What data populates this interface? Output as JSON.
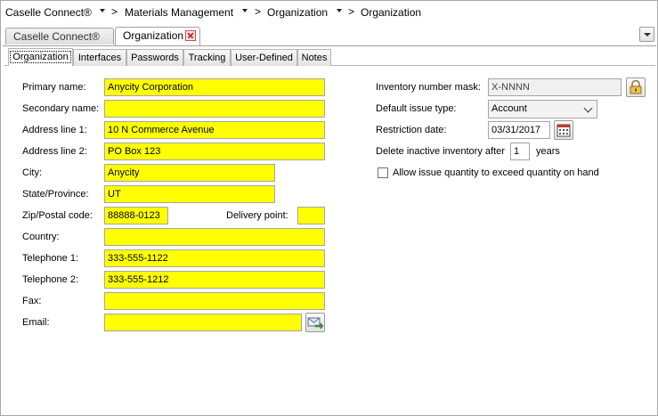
{
  "breadcrumb": {
    "items": [
      "Caselle Connect®",
      "Materials Management",
      "Organization",
      "Organization"
    ],
    "separator": ">"
  },
  "doc_tabs": [
    {
      "label": "Caselle Connect®",
      "active": false
    },
    {
      "label": "Organization",
      "active": true
    }
  ],
  "sub_tabs": [
    "Organization",
    "Interfaces",
    "Passwords",
    "Tracking",
    "User-Defined",
    "Notes"
  ],
  "form": {
    "primary_name": {
      "label": "Primary name:",
      "value": "Anycity Corporation"
    },
    "secondary_name": {
      "label": "Secondary name:",
      "value": ""
    },
    "address1": {
      "label": "Address line 1:",
      "value": "10 N Commerce Avenue"
    },
    "address2": {
      "label": "Address line 2:",
      "value": "PO Box 123"
    },
    "city": {
      "label": "City:",
      "value": "Anycity"
    },
    "state": {
      "label": "State/Province:",
      "value": "UT"
    },
    "zip": {
      "label": "Zip/Postal code:",
      "value": "88888-0123"
    },
    "delivery_point": {
      "label": "Delivery point:",
      "value": ""
    },
    "country": {
      "label": "Country:",
      "value": ""
    },
    "telephone1": {
      "label": "Telephone 1:",
      "value": "333-555-1122"
    },
    "telephone2": {
      "label": "Telephone 2:",
      "value": "333-555-1212"
    },
    "fax": {
      "label": "Fax:",
      "value": ""
    },
    "email": {
      "label": "Email:",
      "value": ""
    }
  },
  "inventory": {
    "mask": {
      "label": "Inventory number mask:",
      "value": "X-NNNN"
    },
    "issue_type": {
      "label": "Default issue type:",
      "value": "Account"
    },
    "restriction_date": {
      "label": "Restriction date:",
      "value": "03/31/2017"
    },
    "delete_inactive": {
      "label": "Delete inactive inventory after",
      "value": "1",
      "suffix": "years"
    },
    "allow_exceed": {
      "label": "Allow issue quantity to exceed quantity on hand",
      "checked": false
    }
  },
  "colors": {
    "required_field": "#ffff00"
  }
}
